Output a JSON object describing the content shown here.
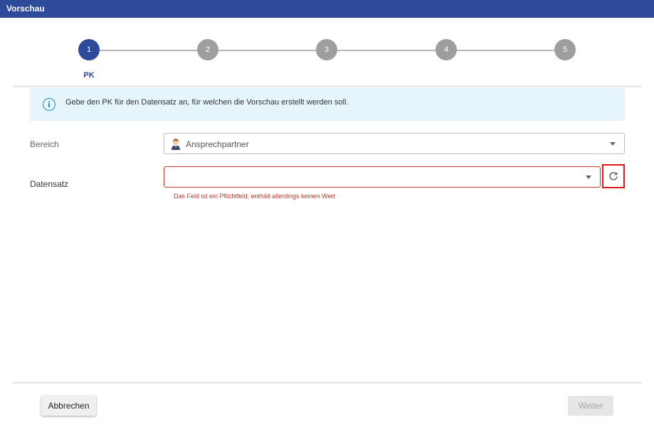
{
  "window": {
    "title": "Vorschau"
  },
  "stepper": {
    "steps": [
      {
        "number": "1",
        "label": "PK"
      },
      {
        "number": "2"
      },
      {
        "number": "3"
      },
      {
        "number": "4"
      },
      {
        "number": "5"
      }
    ],
    "active_step": 1
  },
  "info": {
    "text": "Gebe den PK für den Datensatz an, für welchen die Vorschau erstellt werden soll."
  },
  "form": {
    "bereich": {
      "label": "Bereich",
      "value": "Ansprechpartner",
      "icon": "person-icon"
    },
    "datensatz": {
      "label": "Datensatz",
      "value": "",
      "error": "Das Feld ist ein Pflichtfeld, enthält allerdings keinen Wert"
    }
  },
  "buttons": {
    "cancel": "Abbrechen",
    "next": "Weiter"
  },
  "colors": {
    "accent": "#2e4a9a",
    "error": "#c0392b",
    "info_bg": "#e6f5fc",
    "highlight": "#e0141b"
  }
}
